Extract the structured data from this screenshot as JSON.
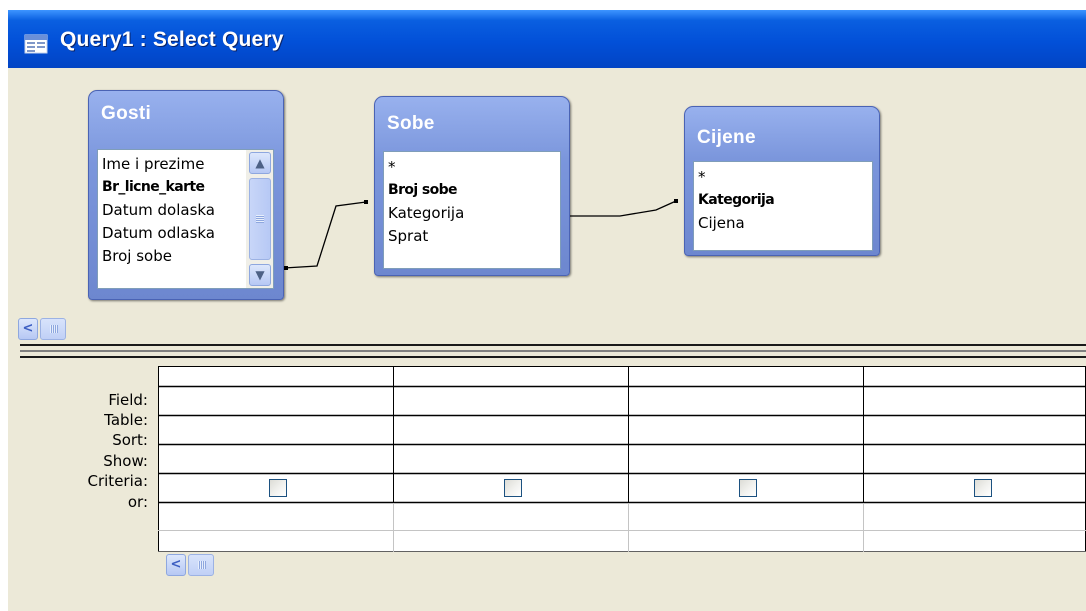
{
  "window": {
    "title": "Query1 : Select Query",
    "icon": "query-window-icon"
  },
  "field_lists": [
    {
      "name": "Gosti",
      "fields": [
        {
          "label": "Ime i prezime",
          "key": false
        },
        {
          "label": "Br_licne_karte",
          "key": true
        },
        {
          "label": "Datum dolaska",
          "key": false
        },
        {
          "label": "Datum odlaska",
          "key": false
        },
        {
          "label": "Broj sobe",
          "key": false
        }
      ],
      "has_scrollbar": true
    },
    {
      "name": "Sobe",
      "fields": [
        {
          "label": "*",
          "key": false
        },
        {
          "label": "Broj sobe",
          "key": true
        },
        {
          "label": "Kategorija",
          "key": false
        },
        {
          "label": "Sprat",
          "key": false
        }
      ],
      "has_scrollbar": false
    },
    {
      "name": "Cijene",
      "fields": [
        {
          "label": "*",
          "key": false
        },
        {
          "label": "Kategorija",
          "key": true
        },
        {
          "label": "Cijena",
          "key": false
        }
      ],
      "has_scrollbar": false
    }
  ],
  "design_grid": {
    "row_labels": [
      "Field:",
      "Table:",
      "Sort:",
      "Show:",
      "Criteria:",
      "or:"
    ],
    "columns": [
      {
        "field": "",
        "table": "",
        "sort": "",
        "show": false,
        "criteria": "",
        "or": ""
      },
      {
        "field": "",
        "table": "",
        "sort": "",
        "show": false,
        "criteria": "",
        "or": ""
      },
      {
        "field": "",
        "table": "",
        "sort": "",
        "show": false,
        "criteria": "",
        "or": ""
      },
      {
        "field": "",
        "table": "",
        "sort": "",
        "show": false,
        "criteria": "",
        "or": ""
      }
    ]
  },
  "colors": {
    "title_bar": "#0250d8",
    "field_list_header": "#7b96dc",
    "window_background": "#ece9d8"
  }
}
